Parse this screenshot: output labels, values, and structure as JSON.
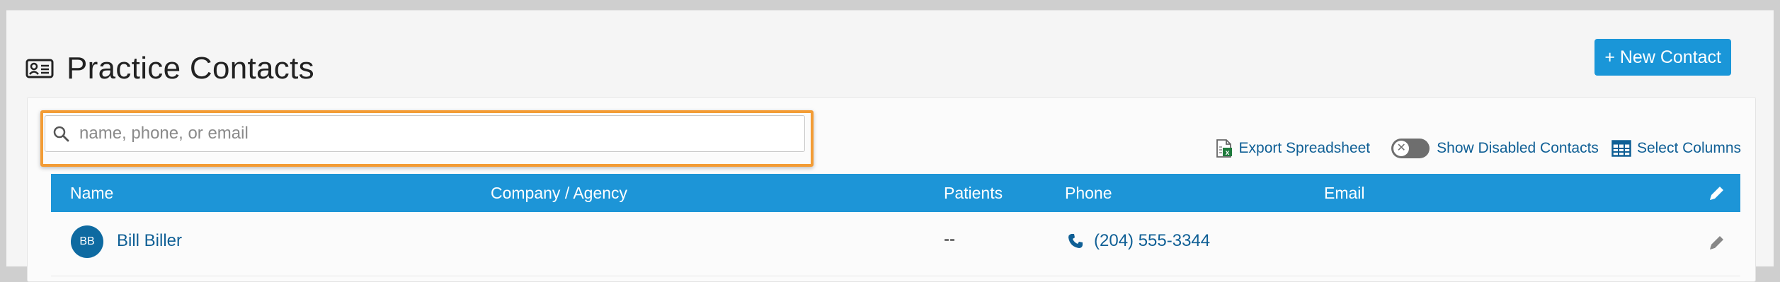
{
  "header": {
    "title": "Practice Contacts",
    "icon": "contact-card-icon"
  },
  "new_contact_button": "+ New Contact",
  "search": {
    "placeholder": "name, phone, or email",
    "value": ""
  },
  "toolbar": {
    "export_label": "Export Spreadsheet",
    "show_disabled_label": "Show Disabled Contacts",
    "show_disabled_on": false,
    "select_columns_label": "Select Columns"
  },
  "table": {
    "columns": [
      "Name",
      "Company / Agency",
      "Patients",
      "Phone",
      "Email"
    ],
    "rows": [
      {
        "initials": "BB",
        "name": "Bill Biller",
        "company": "",
        "patients": "--",
        "phone": "(204) 555-3344",
        "email": ""
      }
    ]
  },
  "colors": {
    "accent": "#1d95d7",
    "link": "#0f5f95",
    "highlight": "#f39c35",
    "avatar": "#0e6aa1"
  }
}
